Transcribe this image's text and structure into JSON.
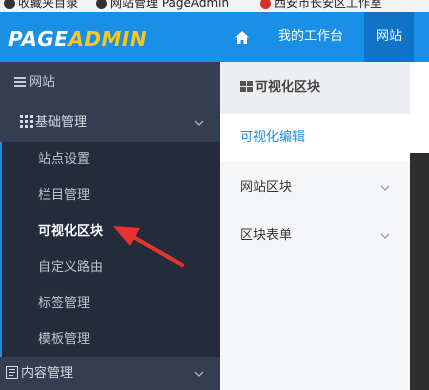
{
  "bookmarks": [
    {
      "label": "收藏夹目录"
    },
    {
      "label": "网站管理 PageAdmin"
    },
    {
      "label": "西安市长安区工作室"
    }
  ],
  "header": {
    "logo_page": "PAGE",
    "logo_admin": "ADMIN",
    "home_icon": "home-icon",
    "workbench_label": "我的工作台",
    "site_label": "网站"
  },
  "sidebar": {
    "title": "网站",
    "group_label": "基础管理",
    "items": [
      {
        "label": "站点设置"
      },
      {
        "label": "栏目管理"
      },
      {
        "label": "可视化区块"
      },
      {
        "label": "自定义路由"
      },
      {
        "label": "标签管理"
      },
      {
        "label": "模板管理"
      }
    ],
    "group2_label": "内容管理"
  },
  "panel": {
    "title": "可视化区块",
    "items": [
      {
        "label": "可视化编辑"
      },
      {
        "label": "网站区块"
      },
      {
        "label": "区块表单"
      }
    ]
  },
  "colors": {
    "header_blue": "#1a8fe6",
    "logo_yellow": "#f7c61f",
    "sidebar_dark": "#2b3345",
    "arrow_red": "#e8322f"
  }
}
